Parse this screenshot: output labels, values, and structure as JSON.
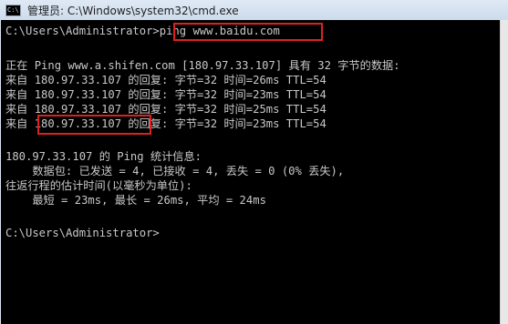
{
  "window": {
    "title": "管理员: C:\\Windows\\system32\\cmd.exe",
    "icon": "cmd-icon",
    "icon_text": "C:\\"
  },
  "console": {
    "lines": [
      "C:\\Users\\Administrator>ping www.baidu.com",
      "",
      "正在 Ping www.a.shifen.com [180.97.33.107] 具有 32 字节的数据:",
      "来自 180.97.33.107 的回复: 字节=32 时间=26ms TTL=54",
      "来自 180.97.33.107 的回复: 字节=32 时间=23ms TTL=54",
      "来自 180.97.33.107 的回复: 字节=32 时间=25ms TTL=54",
      "来自 180.97.33.107 的回复: 字节=32 时间=23ms TTL=54",
      "",
      "180.97.33.107 的 Ping 统计信息:",
      "    数据包: 已发送 = 4, 已接收 = 4, 丢失 = 0 (0% 丢失),",
      "往返行程的估计时间(以毫秒为单位):",
      "    最短 = 23ms, 最长 = 26ms, 平均 = 24ms",
      "",
      "C:\\Users\\Administrator>"
    ]
  },
  "colors": {
    "console_bg": "#000000",
    "console_text": "#c8c8c8",
    "highlight": "#e02020"
  }
}
